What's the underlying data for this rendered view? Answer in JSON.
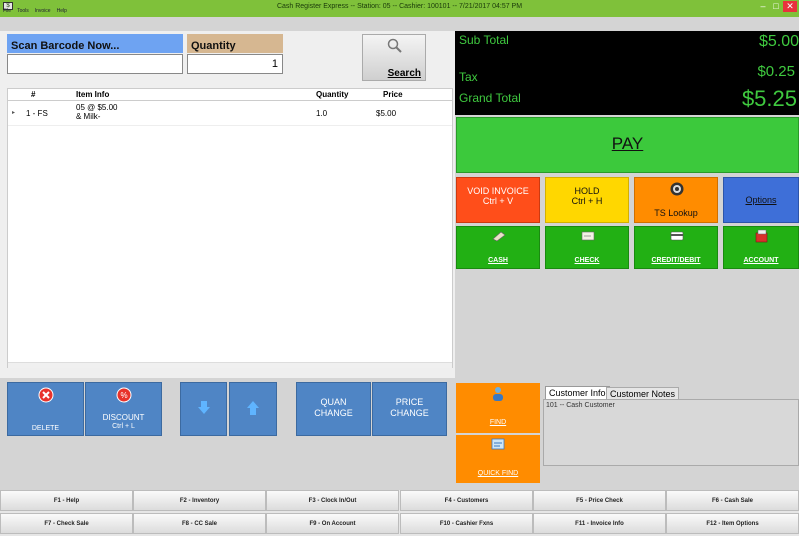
{
  "window": {
    "title": "Cash Register Express -- Station: 05 -- Cashier: 100101 -- 7/21/2017 04:57 PM",
    "minimize": "–",
    "restore": "□",
    "close": "✕"
  },
  "menu": [
    "File",
    "Tools",
    "Invoice",
    "Help"
  ],
  "scan": {
    "label": "Scan Barcode Now...",
    "value": "",
    "qty_label": "Quantity",
    "qty_value": "1",
    "search_label": "Search"
  },
  "table": {
    "columns": [
      "#",
      "Item Info",
      "Quantity",
      "Price"
    ],
    "rows": [
      {
        "num": "1 - FS",
        "info_line1": "05 @  $5.00",
        "info_line2": "& Milk-",
        "qty": "1.0",
        "price": "$5.00"
      }
    ]
  },
  "totals": {
    "sub_label": "Sub Total",
    "sub_value": "$5.00",
    "tax_label": "Tax",
    "tax_value": "$0.25",
    "grand_label": "Grand Total",
    "grand_value": "$5.25"
  },
  "actions": {
    "pay": "PAY",
    "void_line1": "VOID INVOICE",
    "void_line2": "Ctrl + V",
    "hold_line1": "HOLD",
    "hold_line2": "Ctrl + H",
    "ts_lookup": "TS Lookup",
    "options": "Options",
    "cash": "CASH",
    "check": "CHECK",
    "credit": "CREDIT/DEBIT",
    "account": "ACCOUNT"
  },
  "bottom_buttons": {
    "delete": "DELETE",
    "discount_line1": "DISCOUNT",
    "discount_line2": "Ctrl + L",
    "quan_line1": "QUAN",
    "quan_line2": "CHANGE",
    "price_line1": "PRICE",
    "price_line2": "CHANGE",
    "find": "FIND",
    "quick_find": "QUICK FIND"
  },
  "customer": {
    "tab_info": "Customer Info",
    "tab_notes": "Customer Notes",
    "text": "101 -- Cash Customer"
  },
  "fkeys_row1": [
    "F1 - Help",
    "F2 - Inventory",
    "F3 - Clock In/Out",
    "F4 - Customers",
    "F5 - Price Check",
    "F6 - Cash Sale"
  ],
  "fkeys_row2": [
    "F7 - Check Sale",
    "F8 - CC Sale",
    "F9 - On Account",
    "F10 - Cashier Fxns",
    "F11 - Invoice Info",
    "F12 - Item Options"
  ],
  "colors": {
    "title_green": "#7fc13a",
    "pay_green": "#3cc93c",
    "void_red": "#ff4e1a",
    "hold_yellow": "#ffd700",
    "ts_orange": "#ff8c00",
    "options_blue": "#3e6fd8",
    "tender_green": "#22b014",
    "bottom_blue": "#4f85c5"
  }
}
